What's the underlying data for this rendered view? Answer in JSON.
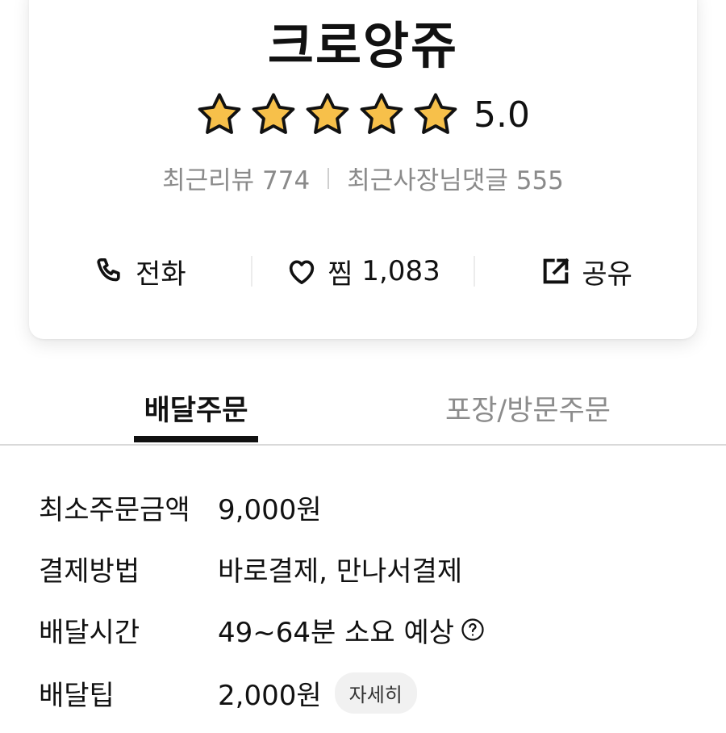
{
  "store": {
    "name": "크로앙쥬",
    "rating": "5.0",
    "stars_filled": 5,
    "stars_total": 5,
    "review_label": "최근리뷰",
    "review_count": "774",
    "owner_reply_label": "최근사장님댓글",
    "owner_reply_count": "555"
  },
  "actions": {
    "call": {
      "label": "전화",
      "icon": "phone-icon"
    },
    "like": {
      "label": "찜",
      "count": "1,083",
      "icon": "heart-icon"
    },
    "share": {
      "label": "공유",
      "icon": "share-icon"
    }
  },
  "tabs": [
    {
      "label": "배달주문",
      "active": true
    },
    {
      "label": "포장/방문주문",
      "active": false
    }
  ],
  "info": {
    "min_order": {
      "label": "최소주문금액",
      "value": "9,000원"
    },
    "payment": {
      "label": "결제방법",
      "value": "바로결제, 만나서결제"
    },
    "delivery_time": {
      "label": "배달시간",
      "value": "49~64분 소요 예상",
      "icon": "question-circle-icon"
    },
    "delivery_tip": {
      "label": "배달팁",
      "value": "2,000원",
      "detail_button": "자세히"
    }
  },
  "colors": {
    "star_fill": "#F7C04A",
    "text_primary": "#111111",
    "text_secondary": "#8A8A8A"
  }
}
